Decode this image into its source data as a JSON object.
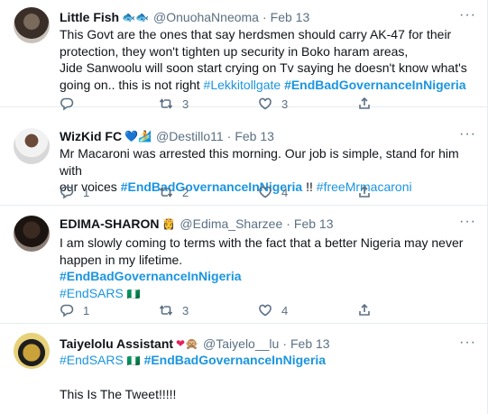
{
  "tweets": [
    {
      "name": "Little Fish",
      "name_emoji": "🐟🐟",
      "handle": "@OnuohaNneoma",
      "dot": "·",
      "date": "Feb 13",
      "text_lines": [
        "This Govt are the ones that say herdsmen should carry AK-47 for their",
        "protection, they won't tighten up security in  Boko haram areas,",
        "Jide Sanwoolu will soon start crying on Tv saying he doesn't know what's",
        "going on.. this is not right "
      ],
      "tags": [
        "#Lekkitollgate",
        "#EndBadGovernanceInNigeria"
      ],
      "replies": "",
      "retweets": "3",
      "likes": "3"
    },
    {
      "name": "WizKid FC",
      "name_emoji": "💙🏄",
      "handle": "@Destillo11",
      "dot": "·",
      "date": "Feb 13",
      "text_lines": [
        "Mr Macaroni was arrested this morning. Our job is simple, stand for him with",
        "our voices "
      ],
      "tags": [
        "#EndBadGovernanceInNigeria",
        "#freeMrmacaroni"
      ],
      "between": " !! ",
      "replies": "1",
      "retweets": "2",
      "likes": "4"
    },
    {
      "name": "EDIMA-SHARON",
      "name_emoji": "👸",
      "handle": "@Edima_Sharzee",
      "dot": "·",
      "date": "Feb 13",
      "text_lines": [
        "I am slowly coming to terms with the fact that a better Nigeria may never",
        "happen in my lifetime."
      ],
      "tags": [
        "#EndBadGovernanceInNigeria",
        "#EndSARS"
      ],
      "tag_emoji": "🇳🇬",
      "replies": "1",
      "retweets": "3",
      "likes": "4"
    },
    {
      "name": "Taiyelolu Assistant",
      "name_emoji": "❤🙊",
      "handle": "@Taiyelo__lu",
      "dot": "·",
      "date": "Feb 13",
      "tags": [
        "#EndSARS",
        "#EndBadGovernanceInNigeria"
      ],
      "tag_emoji": "🇳🇬",
      "text_lines": [
        "This Is The Tweet!!!!!"
      ]
    }
  ],
  "icons": {
    "more": "more-horizontal-icon",
    "reply": "reply-icon",
    "retweet": "retweet-icon",
    "like": "like-icon",
    "share": "share-icon"
  },
  "colors": {
    "link": "#1b95e0",
    "secondary": "#5b7083",
    "border": "#e6ecf0",
    "text": "#0f1419"
  }
}
